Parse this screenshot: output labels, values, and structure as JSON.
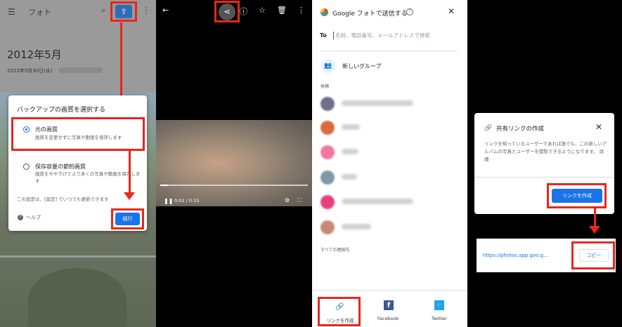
{
  "panel1": {
    "app_title": "フォト",
    "date_heading": "2012年5月",
    "subdate": "2012年5月30日(水)",
    "dialog": {
      "title": "バックアップの画質を選択する",
      "option1_title": "元の画質",
      "option1_desc": "画質を変更せずに写真や動画を保存します",
      "option2_title": "保存容量の節約画質",
      "option2_desc": "画質をやや下げてより多くの写真や動画を保存します",
      "note": "この設定は、[設定] でいつでも更新できます",
      "help": "ヘルプ",
      "continue": "続行"
    }
  },
  "panel2": {
    "video_time": "0:02 / 0:15",
    "video_progress": 0.05
  },
  "panel3": {
    "title": "Google フォトで送信する",
    "to_label": "To",
    "to_placeholder": "名前、電話番号、メールアドレスで検索",
    "new_group": "新しいグループ",
    "suggestions": "候補",
    "all_contacts": "すべての連絡先",
    "share_options": [
      {
        "label": "リンクを作成"
      },
      {
        "label": "Facebook"
      },
      {
        "label": "Twitter"
      }
    ],
    "contact_colors": [
      "#6d6e8c",
      "#d9693f",
      "#f0789e",
      "#8097a8",
      "#e6407a",
      "#c58a77"
    ]
  },
  "panel4": {
    "dialog": {
      "title": "共有リンクの作成",
      "desc": "リンクを知っているユーザーであれば誰でも、この新しいアルバムの写真とユーザーを閲覧できるようになります。 詳細",
      "create_button": "リンクを作成"
    },
    "url": "https://photos.app.goo.g...",
    "copy_button": "コピー"
  },
  "accent_colors": {
    "highlight": "#e8271d",
    "primary": "#1a73e8"
  }
}
